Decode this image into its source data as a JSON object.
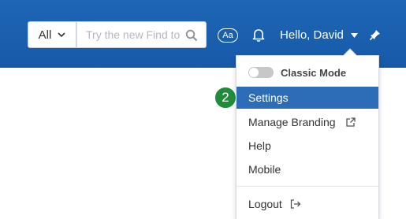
{
  "header": {
    "scope_label": "All",
    "search_placeholder": "Try the new Find tool",
    "text_size_label": "Aa",
    "user_greeting": "Hello, David",
    "icons": [
      "chevron-down-icon",
      "search-icon",
      "bell-icon",
      "pin-icon"
    ]
  },
  "menu": {
    "classic_mode_label": "Classic Mode",
    "classic_mode_enabled": false,
    "items": [
      {
        "label": "Settings",
        "selected": true
      },
      {
        "label": "Manage Branding",
        "icon": "external-link-icon"
      },
      {
        "label": "Help"
      },
      {
        "label": "Mobile"
      },
      {
        "label": "Logout",
        "icon": "logout-icon"
      }
    ]
  },
  "step_badge": "2",
  "colors": {
    "header_bg": "#1f66b6",
    "selected_bg": "#2d6db7",
    "badge_bg": "#1f8b3b"
  }
}
